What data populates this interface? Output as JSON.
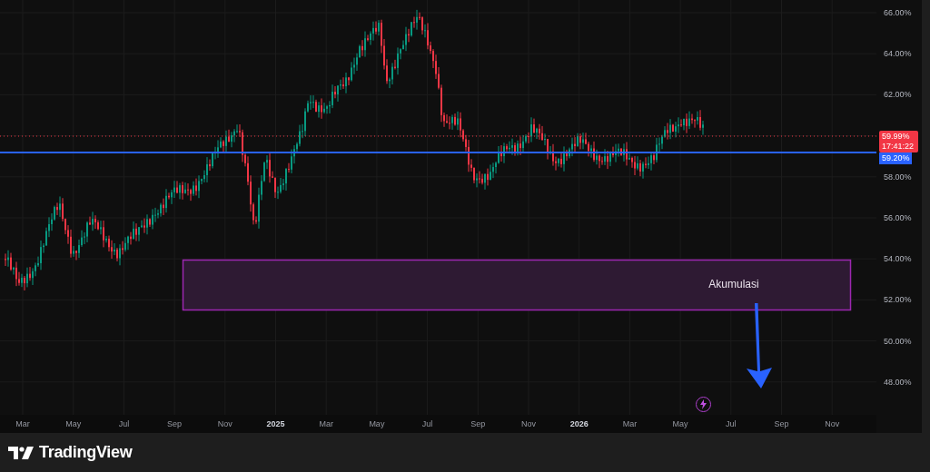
{
  "chart": {
    "price_axis": {
      "upper_labels": [
        "66.00%",
        "64.00%",
        "62.00%"
      ],
      "lower_labels": [
        "58.00%",
        "56.00%",
        "54.00%",
        "52.00%",
        "50.00%",
        "48.00%"
      ]
    },
    "time_axis": {
      "labels": [
        {
          "text": "Mar",
          "kind": "month"
        },
        {
          "text": "May",
          "kind": "month"
        },
        {
          "text": "Jul",
          "kind": "month"
        },
        {
          "text": "Sep",
          "kind": "month"
        },
        {
          "text": "Nov",
          "kind": "month"
        },
        {
          "text": "2025",
          "kind": "year"
        },
        {
          "text": "Mar",
          "kind": "month"
        },
        {
          "text": "May",
          "kind": "month"
        },
        {
          "text": "Jul",
          "kind": "month"
        },
        {
          "text": "Sep",
          "kind": "month"
        },
        {
          "text": "Nov",
          "kind": "month"
        },
        {
          "text": "2026",
          "kind": "year"
        },
        {
          "text": "Mar",
          "kind": "month"
        },
        {
          "text": "May",
          "kind": "month"
        },
        {
          "text": "Jul",
          "kind": "month"
        },
        {
          "text": "Sep",
          "kind": "month"
        },
        {
          "text": "Nov",
          "kind": "month"
        }
      ]
    },
    "last_price": {
      "value": "59.99%",
      "countdown": "17:41:22"
    },
    "level_line": {
      "value": "59.20%"
    },
    "annotation": {
      "text": "Akumulasi"
    }
  },
  "footer": {
    "logo_text": "TradingView"
  }
}
